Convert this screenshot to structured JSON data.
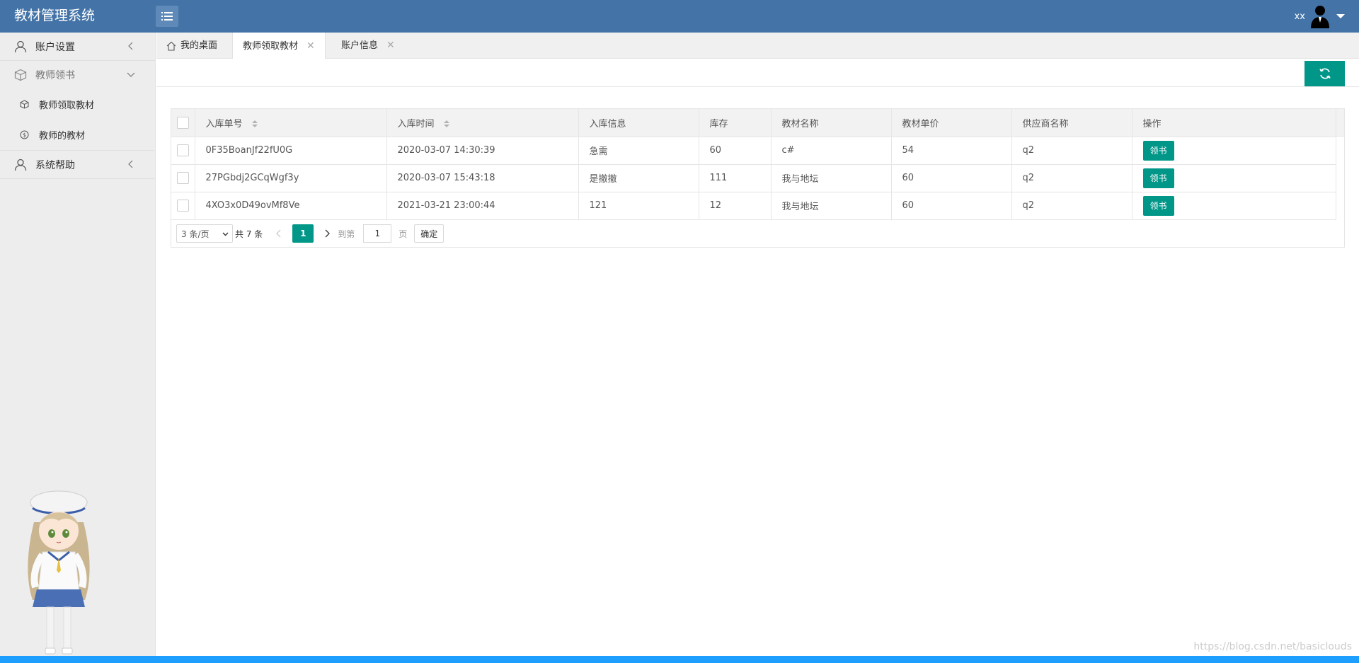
{
  "header": {
    "title": "教材管理系统",
    "username": "xx"
  },
  "sidebar": {
    "items": [
      {
        "label": "账户设置",
        "icon": "user-icon"
      },
      {
        "label": "教师领书",
        "icon": "box-icon",
        "children": [
          {
            "label": "教师领取教材",
            "icon": "cube-icon"
          },
          {
            "label": "教师的教材",
            "icon": "dollar-circle-icon"
          }
        ]
      },
      {
        "label": "系统帮助",
        "icon": "user-icon"
      }
    ]
  },
  "tabs": [
    {
      "label": "我的桌面",
      "icon": "home-icon"
    },
    {
      "label": "教师领取教材",
      "closable": true,
      "active": true
    },
    {
      "label": "账户信息",
      "closable": true
    }
  ],
  "table": {
    "columns": [
      "入库单号",
      "入库时间",
      "入库信息",
      "库存",
      "教材名称",
      "教材单价",
      "供应商名称",
      "操作"
    ],
    "rows": [
      {
        "id": "0F35BoanJf22fU0G",
        "time": "2020-03-07 14:30:39",
        "info": "急需",
        "stock": "60",
        "name": "c#",
        "price": "54",
        "supplier": "q2",
        "action": "领书"
      },
      {
        "id": "27PGbdj2GCqWgf3y",
        "time": "2020-03-07 15:43:18",
        "info": "是撤撤",
        "stock": "111",
        "name": "我与地坛",
        "price": "60",
        "supplier": "q2",
        "action": "领书"
      },
      {
        "id": "4XO3x0D49ovMf8Ve",
        "time": "2021-03-21 23:00:44",
        "info": "121",
        "stock": "12",
        "name": "我与地坛",
        "price": "60",
        "supplier": "q2",
        "action": "领书"
      }
    ]
  },
  "pager": {
    "page_size": "3 条/页",
    "total": "共 7 条",
    "current_page": "1",
    "goto_label": "到第",
    "goto_value": "1",
    "page_unit": "页",
    "confirm": "确定"
  },
  "watermark": "https://blog.csdn.net/basiclouds",
  "colors": {
    "header": "#4474a7",
    "accent": "#009688",
    "bottom_bar": "#1e9fff"
  }
}
